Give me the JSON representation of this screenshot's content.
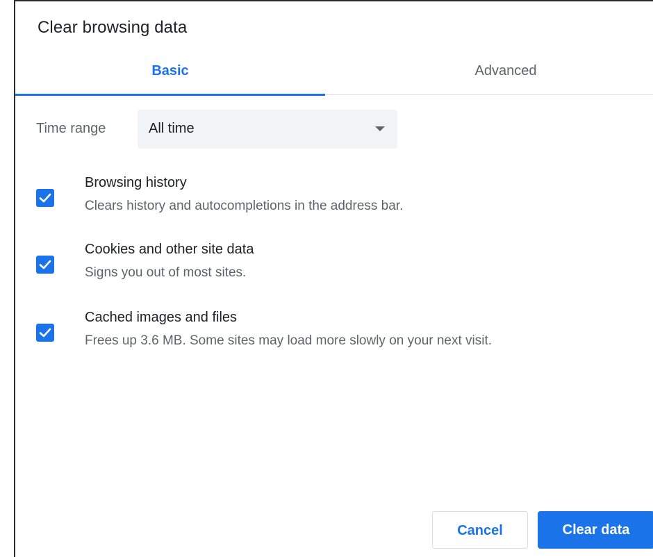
{
  "dialog": {
    "title": "Clear browsing data"
  },
  "tabs": [
    {
      "label": "Basic",
      "active": true
    },
    {
      "label": "Advanced",
      "active": false
    }
  ],
  "time_range": {
    "label": "Time range",
    "selected": "All time"
  },
  "options": [
    {
      "title": "Browsing history",
      "description": "Clears history and autocompletions in the address bar.",
      "checked": true
    },
    {
      "title": "Cookies and other site data",
      "description": "Signs you out of most sites.",
      "checked": true
    },
    {
      "title": "Cached images and files",
      "description": "Frees up 3.6 MB. Some sites may load more slowly on your next visit.",
      "checked": true
    }
  ],
  "buttons": {
    "cancel": "Cancel",
    "clear": "Clear data"
  },
  "colors": {
    "accent": "#1a73e8",
    "text_primary": "#202124",
    "text_secondary": "#5f6368",
    "select_bg": "#f1f3f4"
  },
  "icons": {
    "checkbox": "check-icon",
    "dropdown": "dropdown-arrow-icon"
  }
}
